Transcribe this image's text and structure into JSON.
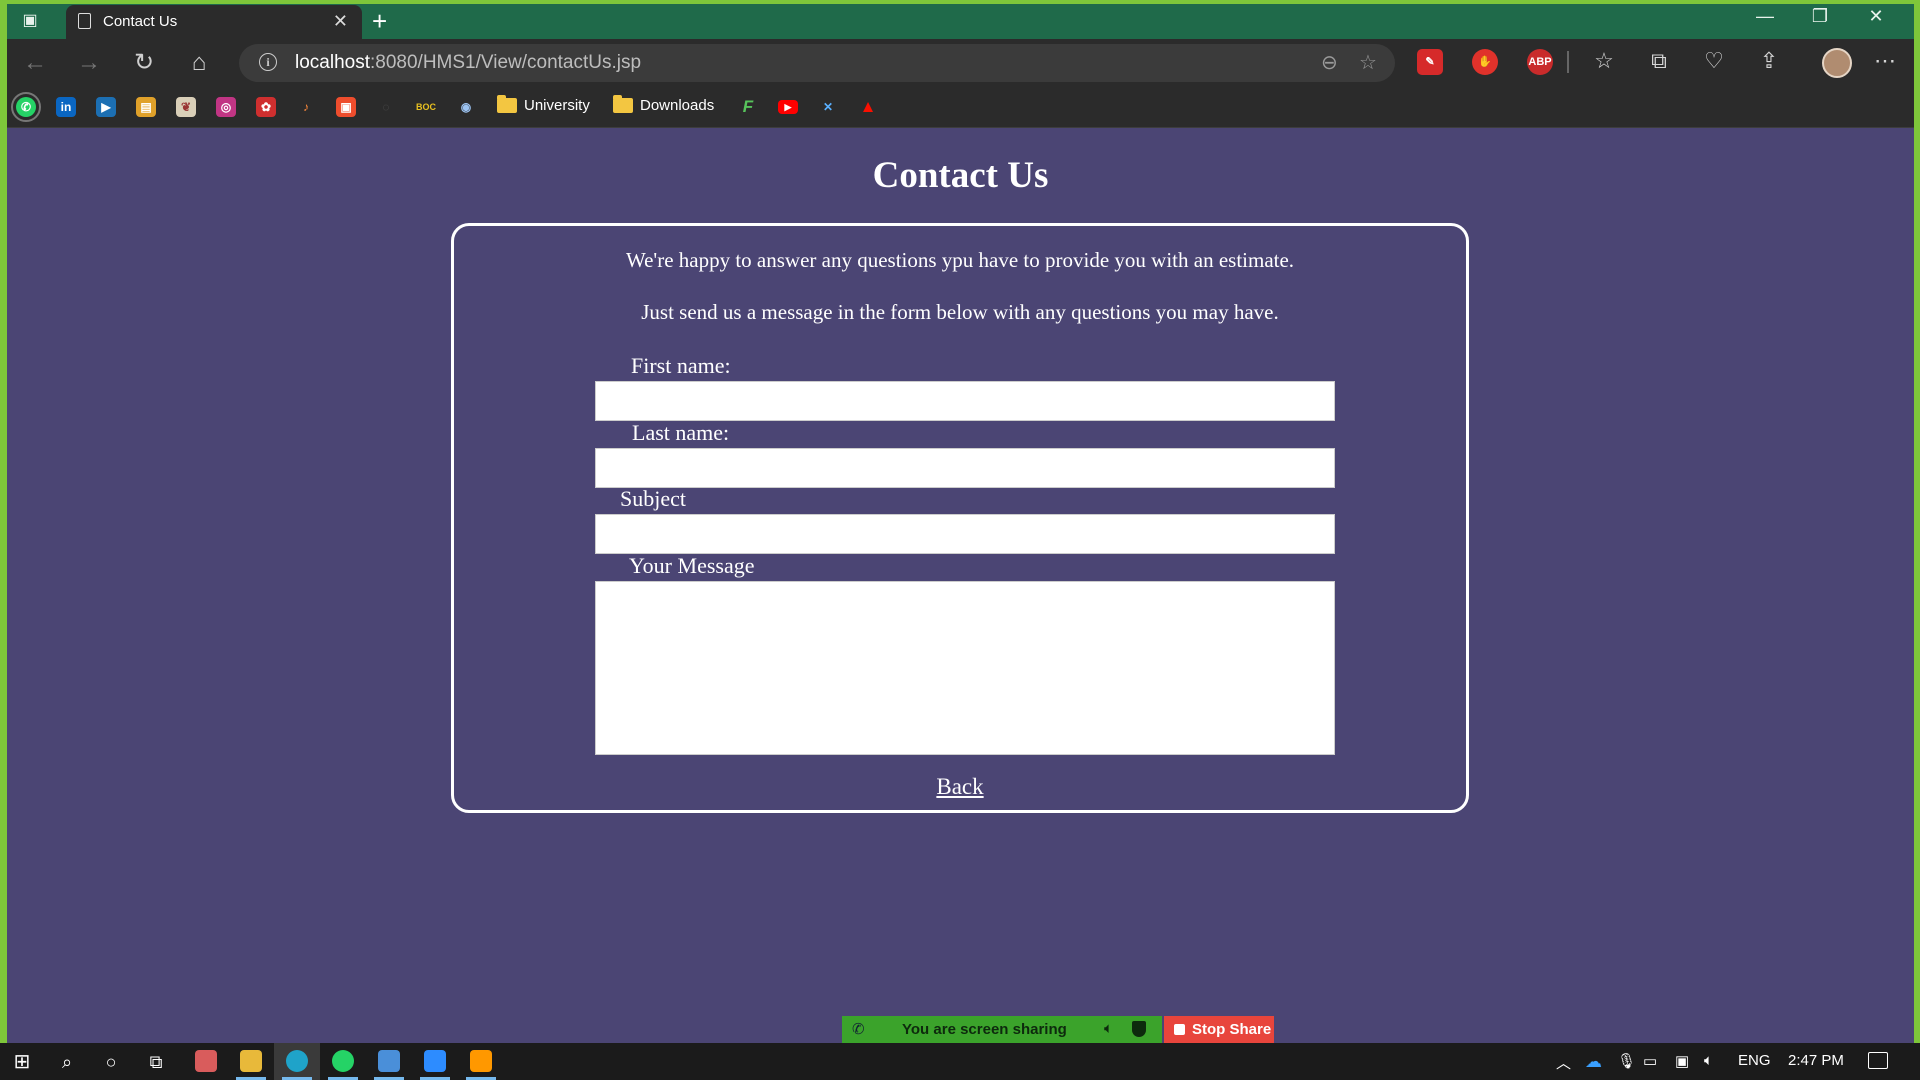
{
  "browser": {
    "tab_title": "Contact Us",
    "url_host": "localhost",
    "url_rest": ":8080/HMS1/View/contactUs.jsp",
    "bookmark_folders": [
      "University",
      "Downloads"
    ],
    "extension_abp_label": "ABP"
  },
  "page": {
    "title": "Contact Us",
    "intro_line1": "We're happy to answer any questions ypu have to provide you with an estimate.",
    "intro_line2": "Just send us a message in the form below with any questions you may have.",
    "form": {
      "first_name_label": "First name:",
      "last_name_label": "Last name:",
      "subject_label": "Subject",
      "message_label": "Your Message",
      "first_name_value": "",
      "last_name_value": "",
      "subject_value": "",
      "message_value": ""
    },
    "back_link": "Back"
  },
  "share_banner": {
    "status_text": "You are screen sharing",
    "stop_label": "Stop Share"
  },
  "taskbar": {
    "language": "ENG",
    "time": "2:47 PM"
  },
  "colors": {
    "page_background": "#4b4574",
    "window_border": "#7ec63a",
    "tab_strip": "#1f6a4a",
    "share_green": "#3ba32b",
    "stop_red": "#e8453c"
  }
}
